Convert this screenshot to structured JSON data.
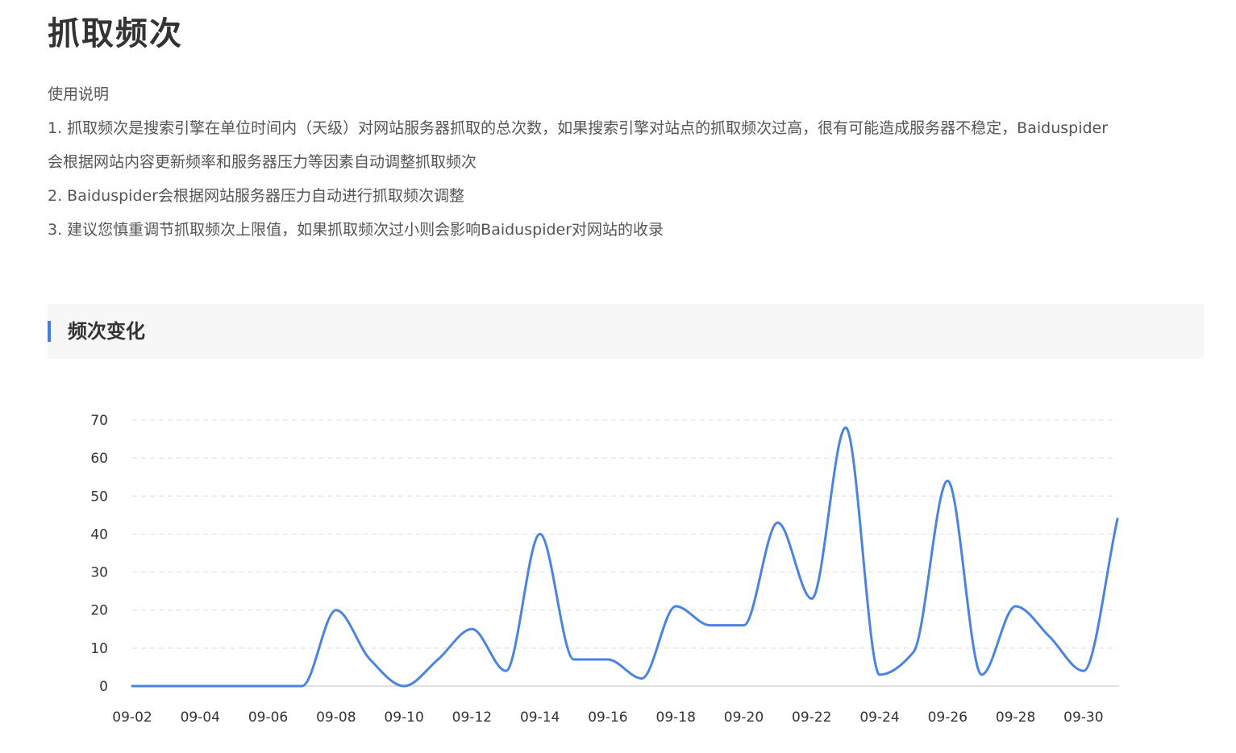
{
  "page": {
    "title": "抓取频次",
    "description": {
      "heading": "使用说明",
      "items": [
        "1. 抓取频次是搜索引擎在单位时间内（天级）对网站服务器抓取的总次数，如果搜索引擎对站点的抓取频次过高，很有可能造成服务器不稳定，Baiduspider",
        "会根据网站内容更新频率和服务器压力等因素自动调整抓取频次",
        "2. Baiduspider会根据网站服务器压力自动进行抓取频次调整",
        "3. 建议您慎重调节抓取频次上限值，如果抓取频次过小则会影响Baiduspider对网站的收录"
      ]
    },
    "section_title": "频次变化"
  },
  "colors": {
    "accent": "#3f7ee8",
    "line": "#4a84e0",
    "grid": "#e3e3e3",
    "header_bg": "#f7f7f7"
  },
  "chart_data": {
    "type": "line",
    "title": "",
    "xlabel": "",
    "ylabel": "",
    "ylim": [
      0,
      70
    ],
    "yticks": [
      0,
      10,
      20,
      30,
      40,
      50,
      60,
      70
    ],
    "grid": true,
    "grid_style": "dashed",
    "smooth": true,
    "x": [
      "09-02",
      "09-03",
      "09-04",
      "09-05",
      "09-06",
      "09-07",
      "09-08",
      "09-09",
      "09-10",
      "09-11",
      "09-12",
      "09-13",
      "09-14",
      "09-15",
      "09-16",
      "09-17",
      "09-18",
      "09-19",
      "09-20",
      "09-21",
      "09-22",
      "09-23",
      "09-24",
      "09-25",
      "09-26",
      "09-27",
      "09-28",
      "09-29",
      "09-30",
      "10-01"
    ],
    "xtick_labels": [
      "09-02",
      "09-04",
      "09-06",
      "09-08",
      "09-10",
      "09-12",
      "09-14",
      "09-16",
      "09-18",
      "09-20",
      "09-22",
      "09-24",
      "09-26",
      "09-28",
      "09-30"
    ],
    "series": [
      {
        "values": [
          0,
          0,
          0,
          0,
          0,
          0,
          20,
          7,
          0,
          7,
          15,
          4,
          40,
          7,
          7,
          2,
          21,
          16,
          16,
          43,
          23,
          68,
          3,
          9,
          54,
          3,
          21,
          13,
          4,
          44
        ]
      }
    ]
  }
}
